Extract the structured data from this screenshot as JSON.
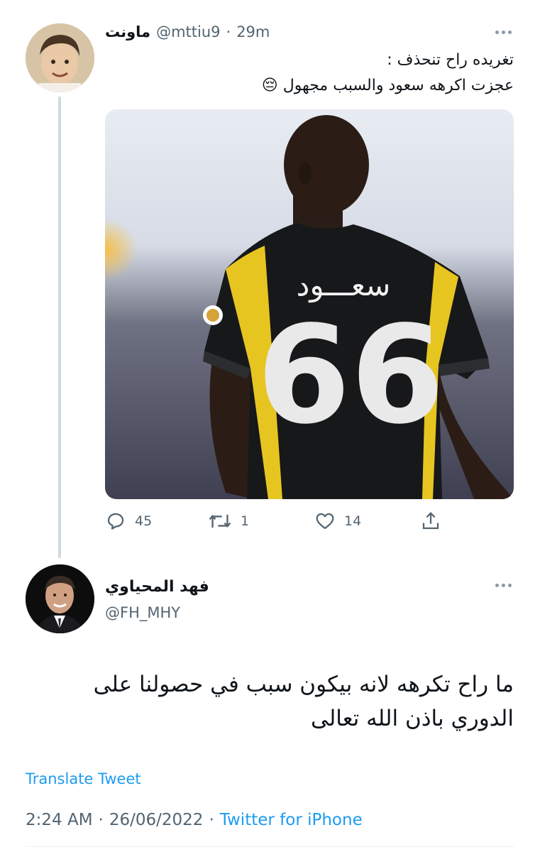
{
  "tweet1": {
    "display_name": "ماونت",
    "handle": "@mttiu9",
    "separator": "·",
    "time": "29m",
    "text_line1": "تغريده راح تنحذف :",
    "text_line2": "عجزت اكرهه سعود والسبب مجهول 😔",
    "jersey_name": "سعـــود",
    "jersey_number": "66",
    "actions": {
      "replies": "45",
      "retweets": "1",
      "likes": "14"
    }
  },
  "tweet2": {
    "display_name": "فهد المحياوي",
    "handle": "@FH_MHY",
    "text_line1": "ما راح تكرهه لانه بيكون سبب في حصولنا على",
    "text_line2": "الدوري باذن الله تعالى",
    "translate_label": "Translate Tweet",
    "time": "2:24 AM",
    "date": "26/06/2022",
    "separator": "·",
    "source": "Twitter for iPhone"
  }
}
